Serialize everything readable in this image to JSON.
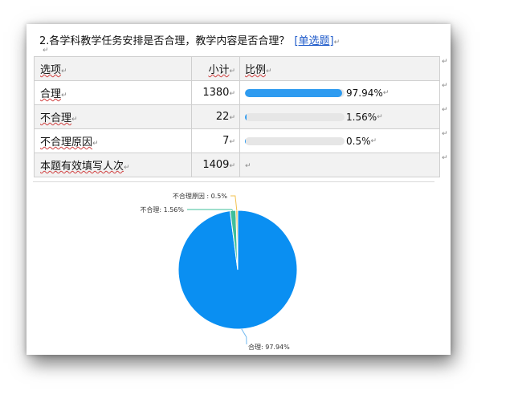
{
  "question": {
    "text": "2.各学科教学任务安排是否合理，教学内容是否合理？",
    "tag": "[单选题]"
  },
  "table": {
    "headers": [
      "选项",
      "小计",
      "比例"
    ],
    "rows": [
      {
        "label": "合理",
        "count": "1380",
        "pct_text": "97.94%",
        "pct": 97.94
      },
      {
        "label": "不合理",
        "count": "22",
        "pct_text": "1.56%",
        "pct": 1.56
      },
      {
        "label": "不合理原因",
        "count": "7",
        "pct_text": "0.5%",
        "pct": 0.5
      }
    ],
    "total": {
      "label": "本题有效填写人次",
      "count": "1409"
    }
  },
  "chart_data": {
    "type": "pie",
    "categories": [
      "合理",
      "不合理",
      "不合理原因"
    ],
    "values": [
      97.94,
      1.56,
      0.5
    ],
    "labels": [
      "合理: 97.94%",
      "不合理: 1.56%",
      "不合理原因 : 0.5%"
    ],
    "colors": [
      "#0a8ff2",
      "#3fbf9a",
      "#f2c14e"
    ],
    "title": "",
    "legend": "none"
  },
  "colors": {
    "bar_fill": "#2e9bf0",
    "bar_track": "#e6e6e6",
    "link": "#1a57c9"
  }
}
